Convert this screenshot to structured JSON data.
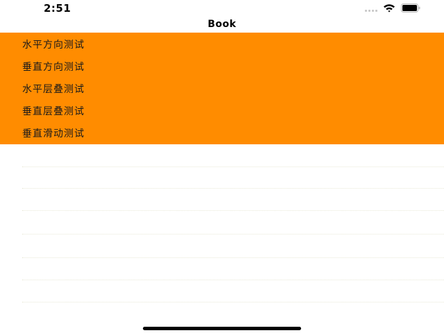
{
  "status_bar": {
    "time": "2:51"
  },
  "nav": {
    "title": "Book"
  },
  "menu": {
    "items": [
      {
        "label": "水平方向测试"
      },
      {
        "label": "垂直方向测试"
      },
      {
        "label": "水平层叠测试"
      },
      {
        "label": "垂直层叠测试"
      },
      {
        "label": "垂直滑动测试"
      }
    ]
  },
  "icons": {
    "signal": "cellular-signal-icon",
    "wifi": "wifi-icon",
    "battery": "battery-icon"
  },
  "colors": {
    "accent": "#ff8c00",
    "background": "#ffffff",
    "text": "#1a1a1a"
  }
}
